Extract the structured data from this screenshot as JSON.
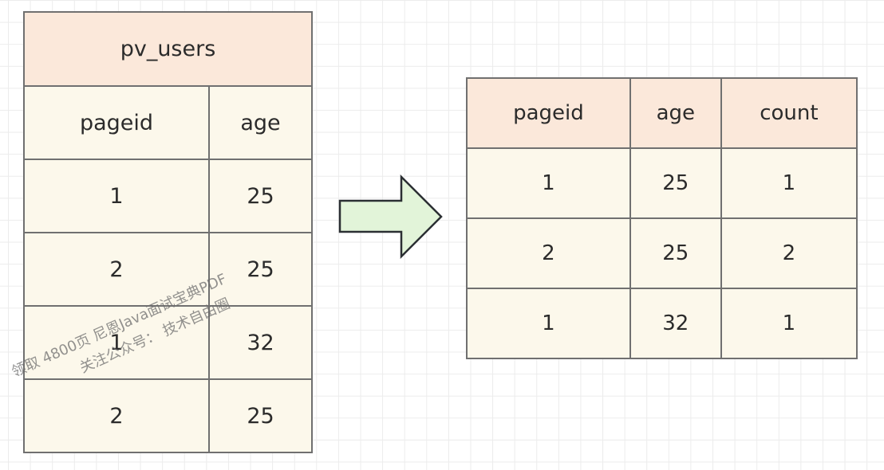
{
  "source_table": {
    "title": "pv_users",
    "columns": [
      "pageid",
      "age"
    ],
    "rows": [
      [
        "1",
        "25"
      ],
      [
        "2",
        "25"
      ],
      [
        "1",
        "32"
      ],
      [
        "2",
        "25"
      ]
    ]
  },
  "arrow": {
    "icon": "right-arrow-icon",
    "fill": "#e2f4d9",
    "stroke": "#2b2f33"
  },
  "result_table": {
    "columns": [
      "pageid",
      "age",
      "count"
    ],
    "rows": [
      [
        "1",
        "25",
        "1"
      ],
      [
        "2",
        "25",
        "2"
      ],
      [
        "1",
        "32",
        "1"
      ]
    ]
  },
  "watermark": {
    "line1": "领取 4800页 尼恩Java面试宝典PDF",
    "line2": "关注公众号：  技术自由圈"
  },
  "colors": {
    "header_bg": "#fbe8da",
    "cell_bg": "#fcf8eb",
    "border": "#707070"
  }
}
